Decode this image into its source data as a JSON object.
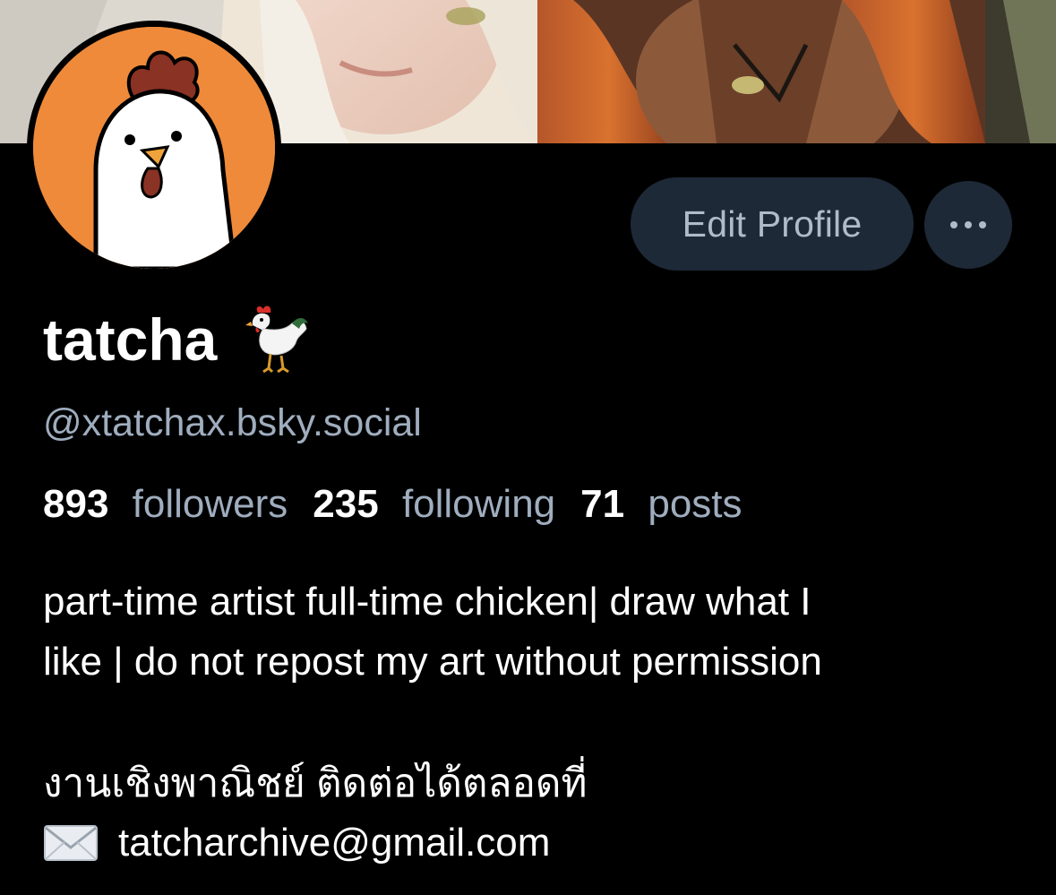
{
  "profile": {
    "display_name": "tatcha",
    "name_emoji_icon": "rooster-icon",
    "handle": "@xtatchax.bsky.social",
    "stats": {
      "followers_count": "893",
      "followers_label": "followers",
      "following_count": "235",
      "following_label": "following",
      "posts_count": "71",
      "posts_label": "posts"
    },
    "bio_lines": [
      "part-time artist full-time chicken| draw what I",
      "like | do not repost my art without permission"
    ],
    "contact_line": "งานเชิงพาณิชย์ ติดต่อได้ตลอดที่",
    "email_icon": "envelope-icon",
    "email": "tatcharchive@gmail.com"
  },
  "actions": {
    "edit_profile_label": "Edit Profile",
    "more_icon": "ellipsis-icon"
  },
  "colors": {
    "background": "#000000",
    "button_bg": "#1e2937",
    "button_text": "#aebbc9",
    "muted_text": "#9fadbe",
    "avatar_bg": "#ee8a3a"
  }
}
